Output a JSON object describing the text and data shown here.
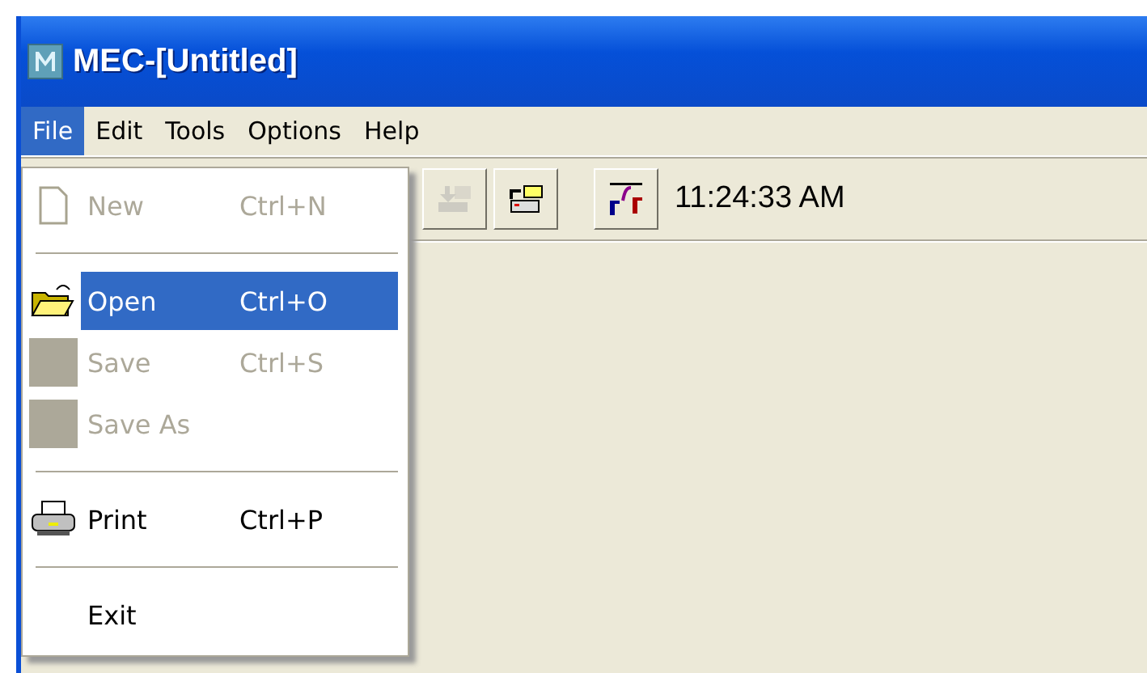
{
  "window": {
    "title": "MEC-[Untitled]"
  },
  "menu": [
    {
      "label": "File",
      "selected": true
    },
    {
      "label": "Edit",
      "selected": false
    },
    {
      "label": "Tools",
      "selected": false
    },
    {
      "label": "Options",
      "selected": false
    },
    {
      "label": "Help",
      "selected": false
    }
  ],
  "file_menu": [
    {
      "kind": "new",
      "label": "New",
      "shortcut": "Ctrl+N",
      "disabled": true,
      "selected": false
    },
    {
      "kind": "separator"
    },
    {
      "kind": "open",
      "label": "Open",
      "shortcut": "Ctrl+O",
      "disabled": false,
      "selected": true
    },
    {
      "kind": "save",
      "label": "Save",
      "shortcut": "Ctrl+S",
      "disabled": true,
      "selected": false
    },
    {
      "kind": "save",
      "label": "Save As",
      "disabled": true,
      "selected": false
    },
    {
      "kind": "separator"
    },
    {
      "kind": "print",
      "label": "Print",
      "shortcut": "Ctrl+P",
      "disabled": false,
      "selected": false
    },
    {
      "kind": "separator"
    },
    {
      "kind": "exit",
      "label": "Exit",
      "disabled": false,
      "selected": false
    }
  ],
  "toolbar": [
    {
      "kind": "import",
      "disabled": true
    },
    {
      "kind": "export",
      "disabled": false
    },
    {
      "kind": "formula",
      "disabled": false
    }
  ],
  "clock": "11:24:33 AM"
}
